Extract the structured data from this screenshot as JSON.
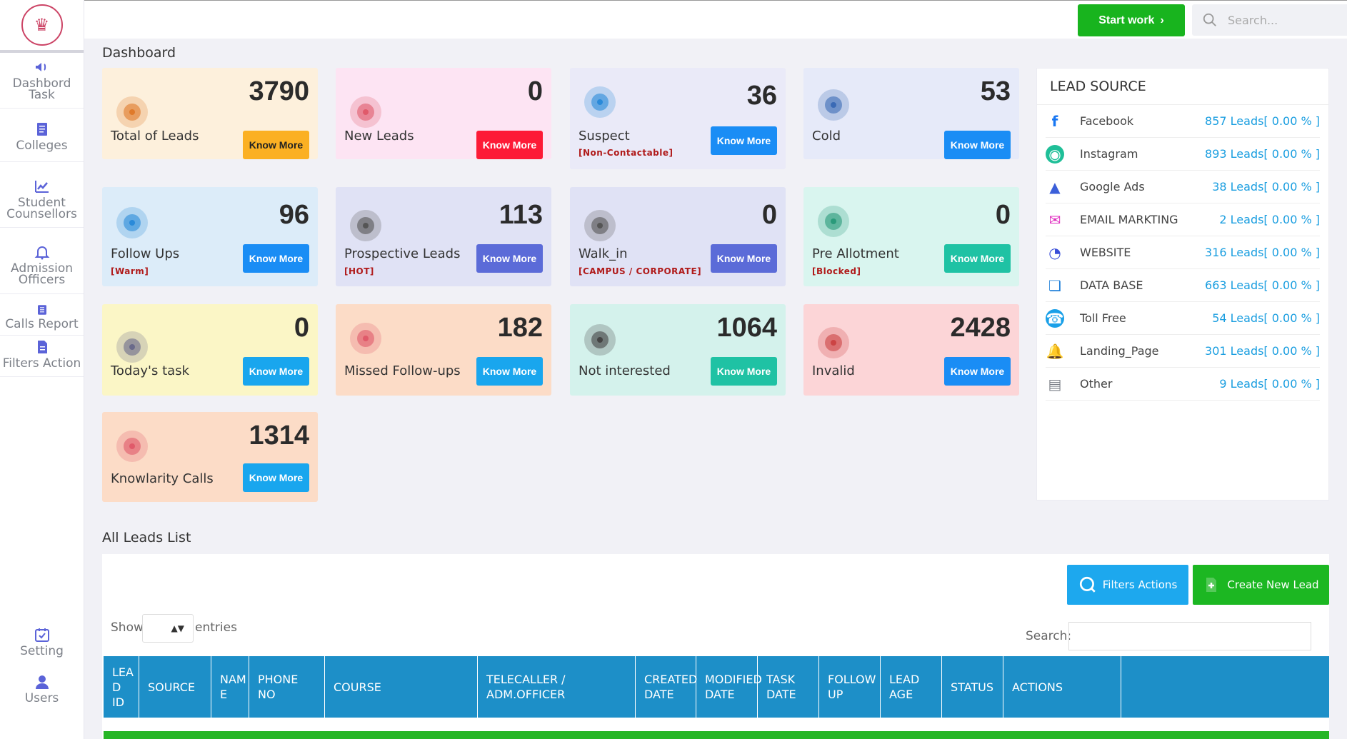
{
  "sidebar": {
    "items": [
      {
        "label": "Dashbord Task"
      },
      {
        "label": "Colleges"
      },
      {
        "label": "Student Counsellors"
      },
      {
        "label": "Admission Officers"
      },
      {
        "label": "Calls Report"
      },
      {
        "label": "Filters Action"
      }
    ],
    "bottom": [
      {
        "label": "Setting"
      },
      {
        "label": "Users"
      }
    ]
  },
  "topbar": {
    "start_work": "Start work",
    "search_placeholder": "Search..."
  },
  "page_title": "Dashboard",
  "cards": [
    {
      "label": "Total of Leads",
      "count": "3790",
      "button": "Know More",
      "sub": "",
      "bg": "#fdf0dc",
      "btn_color": "#fbb023",
      "btn_text": "#222"
    },
    {
      "label": "New Leads",
      "count": "0",
      "button": "Know More",
      "sub": "",
      "bg": "#fde4f3",
      "btn_color": "#fd1a36",
      "btn_text": "#fff"
    },
    {
      "label": "Suspect",
      "count": "36",
      "button": "Know More",
      "sub": "[Non-Contactable]",
      "bg": "#eaeaf8",
      "btn_color": "#1a8df5",
      "btn_text": "#fff"
    },
    {
      "label": "Cold",
      "count": "53",
      "button": "Know More",
      "sub": "",
      "bg": "#e6eaf9",
      "btn_color": "#1a8df5",
      "btn_text": "#fff"
    },
    {
      "label": "Follow Ups",
      "count": "96",
      "button": "Know More",
      "sub": "[Warm]",
      "bg": "#dcecf9",
      "btn_color": "#1a8df5",
      "btn_text": "#fff"
    },
    {
      "label": "Prospective Leads",
      "count": "113",
      "button": "Know More",
      "sub": "[HOT]",
      "bg": "#e0e2f5",
      "btn_color": "#5b6bd8",
      "btn_text": "#fff"
    },
    {
      "label": "Walk_in",
      "count": "0",
      "button": "Know More",
      "sub": "[CAMPUS / CORPORATE]",
      "bg": "#e0e2f5",
      "btn_color": "#5b6bd8",
      "btn_text": "#fff"
    },
    {
      "label": "Pre Allotment",
      "count": "0",
      "button": "Know More",
      "sub": "[Blocked]",
      "bg": "#d9f5ef",
      "btn_color": "#1fc2a4",
      "btn_text": "#fff"
    },
    {
      "label": "Today's task",
      "count": "0",
      "button": "Know More",
      "sub": "",
      "bg": "#fbf6c6",
      "btn_color": "#19a6ee",
      "btn_text": "#fff"
    },
    {
      "label": "Missed Follow-ups",
      "count": "182",
      "button": "Know More",
      "sub": "",
      "bg": "#fcdcc7",
      "btn_color": "#19a6ee",
      "btn_text": "#fff"
    },
    {
      "label": "Not interested",
      "count": "1064",
      "button": "Know More",
      "sub": "",
      "bg": "#d4f2ec",
      "btn_color": "#1fc2a4",
      "btn_text": "#fff"
    },
    {
      "label": "Invalid",
      "count": "2428",
      "button": "Know More",
      "sub": "",
      "bg": "#fcd5d7",
      "btn_color": "#1a8df5",
      "btn_text": "#fff"
    },
    {
      "label": "Knowlarity Calls",
      "count": "1314",
      "button": "Know More",
      "sub": "",
      "bg": "#fcdcc7",
      "btn_color": "#19a6ee",
      "btn_text": "#fff"
    }
  ],
  "lead_source": {
    "title": "LEAD SOURCE",
    "items": [
      {
        "name": "Facebook",
        "count": "857 Leads[ 0.00 % ]",
        "icon": "facebook-icon",
        "color": "#1877f2"
      },
      {
        "name": "Instagram",
        "count": "893 Leads[ 0.00 % ]",
        "icon": "instagram-icon",
        "color": "#1fbf98"
      },
      {
        "name": "Google Ads",
        "count": "38 Leads[ 0.00 % ]",
        "icon": "google-ads-icon",
        "color": "#3b5fd9"
      },
      {
        "name": "EMAIL MARKTING",
        "count": "2 Leads[ 0.00 % ]",
        "icon": "email-icon",
        "color": "#e02fc0"
      },
      {
        "name": "WEBSITE",
        "count": "316 Leads[ 0.00 % ]",
        "icon": "pie-icon",
        "color": "#3b4fd9"
      },
      {
        "name": "DATA BASE",
        "count": "663 Leads[ 0.00 % ]",
        "icon": "database-icon",
        "color": "#1f7fd9"
      },
      {
        "name": "Toll Free",
        "count": "54 Leads[ 0.00 % ]",
        "icon": "phone-icon",
        "color": "#1aa0e8"
      },
      {
        "name": "Landing_Page",
        "count": "301 Leads[ 0.00 % ]",
        "icon": "bell-icon",
        "color": "#f4b400"
      },
      {
        "name": "Other",
        "count": "9 Leads[ 0.00 % ]",
        "icon": "document-icon",
        "color": "#7d8189"
      }
    ]
  },
  "leads_list": {
    "title": "All Leads List",
    "filters_button": "Filters Actions",
    "create_button": "Create New Lead",
    "show_label": "Show",
    "entries_label": "entries",
    "search_label": "Search:",
    "columns": [
      "LEA D ID",
      "SOURCE",
      "NAM E",
      "PHONE NO",
      "COURSE",
      "TELECALLER / ADM.OFFICER",
      "CREATED DATE",
      "MODIFIED DATE",
      "TASK DATE",
      "FOLLOW UP",
      "LEAD AGE",
      "STATUS",
      "ACTIONS"
    ]
  }
}
